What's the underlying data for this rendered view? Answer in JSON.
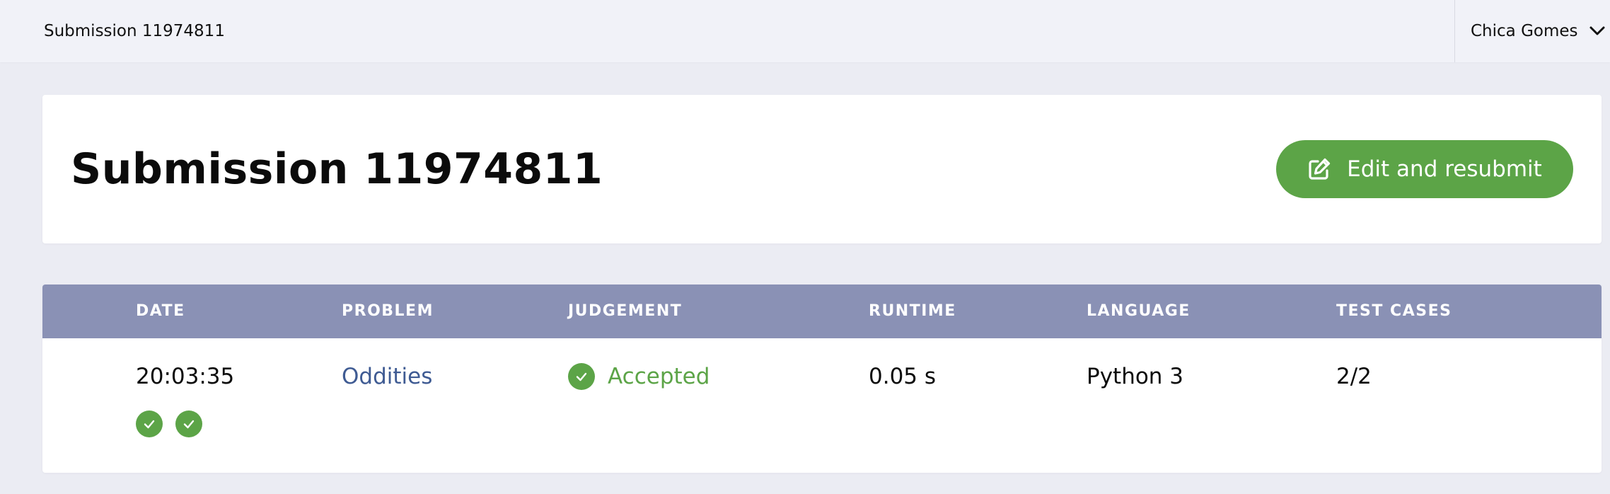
{
  "topbar": {
    "title": "Submission 11974811",
    "user_name": "Chica Gomes"
  },
  "header": {
    "title": "Submission 11974811",
    "edit_button_label": "Edit and resubmit"
  },
  "table": {
    "columns": [
      "DATE",
      "PROBLEM",
      "JUDGEMENT",
      "RUNTIME",
      "LANGUAGE",
      "TEST CASES"
    ],
    "row": {
      "date": "20:03:35",
      "problem": "Oddities",
      "judgement": "Accepted",
      "runtime": "0.05 s",
      "language": "Python 3",
      "test_cases": "2/2",
      "test_case_results": [
        "accepted",
        "accepted"
      ]
    }
  },
  "colors": {
    "accent_green": "#5ca447",
    "table_header": "#8a91b5",
    "link_blue": "#3f5b93",
    "background": "#ebecf3"
  },
  "icons": {
    "edit": "pencil-square-icon",
    "dropdown": "chevron-down-icon",
    "status": "check-circle-icon"
  }
}
